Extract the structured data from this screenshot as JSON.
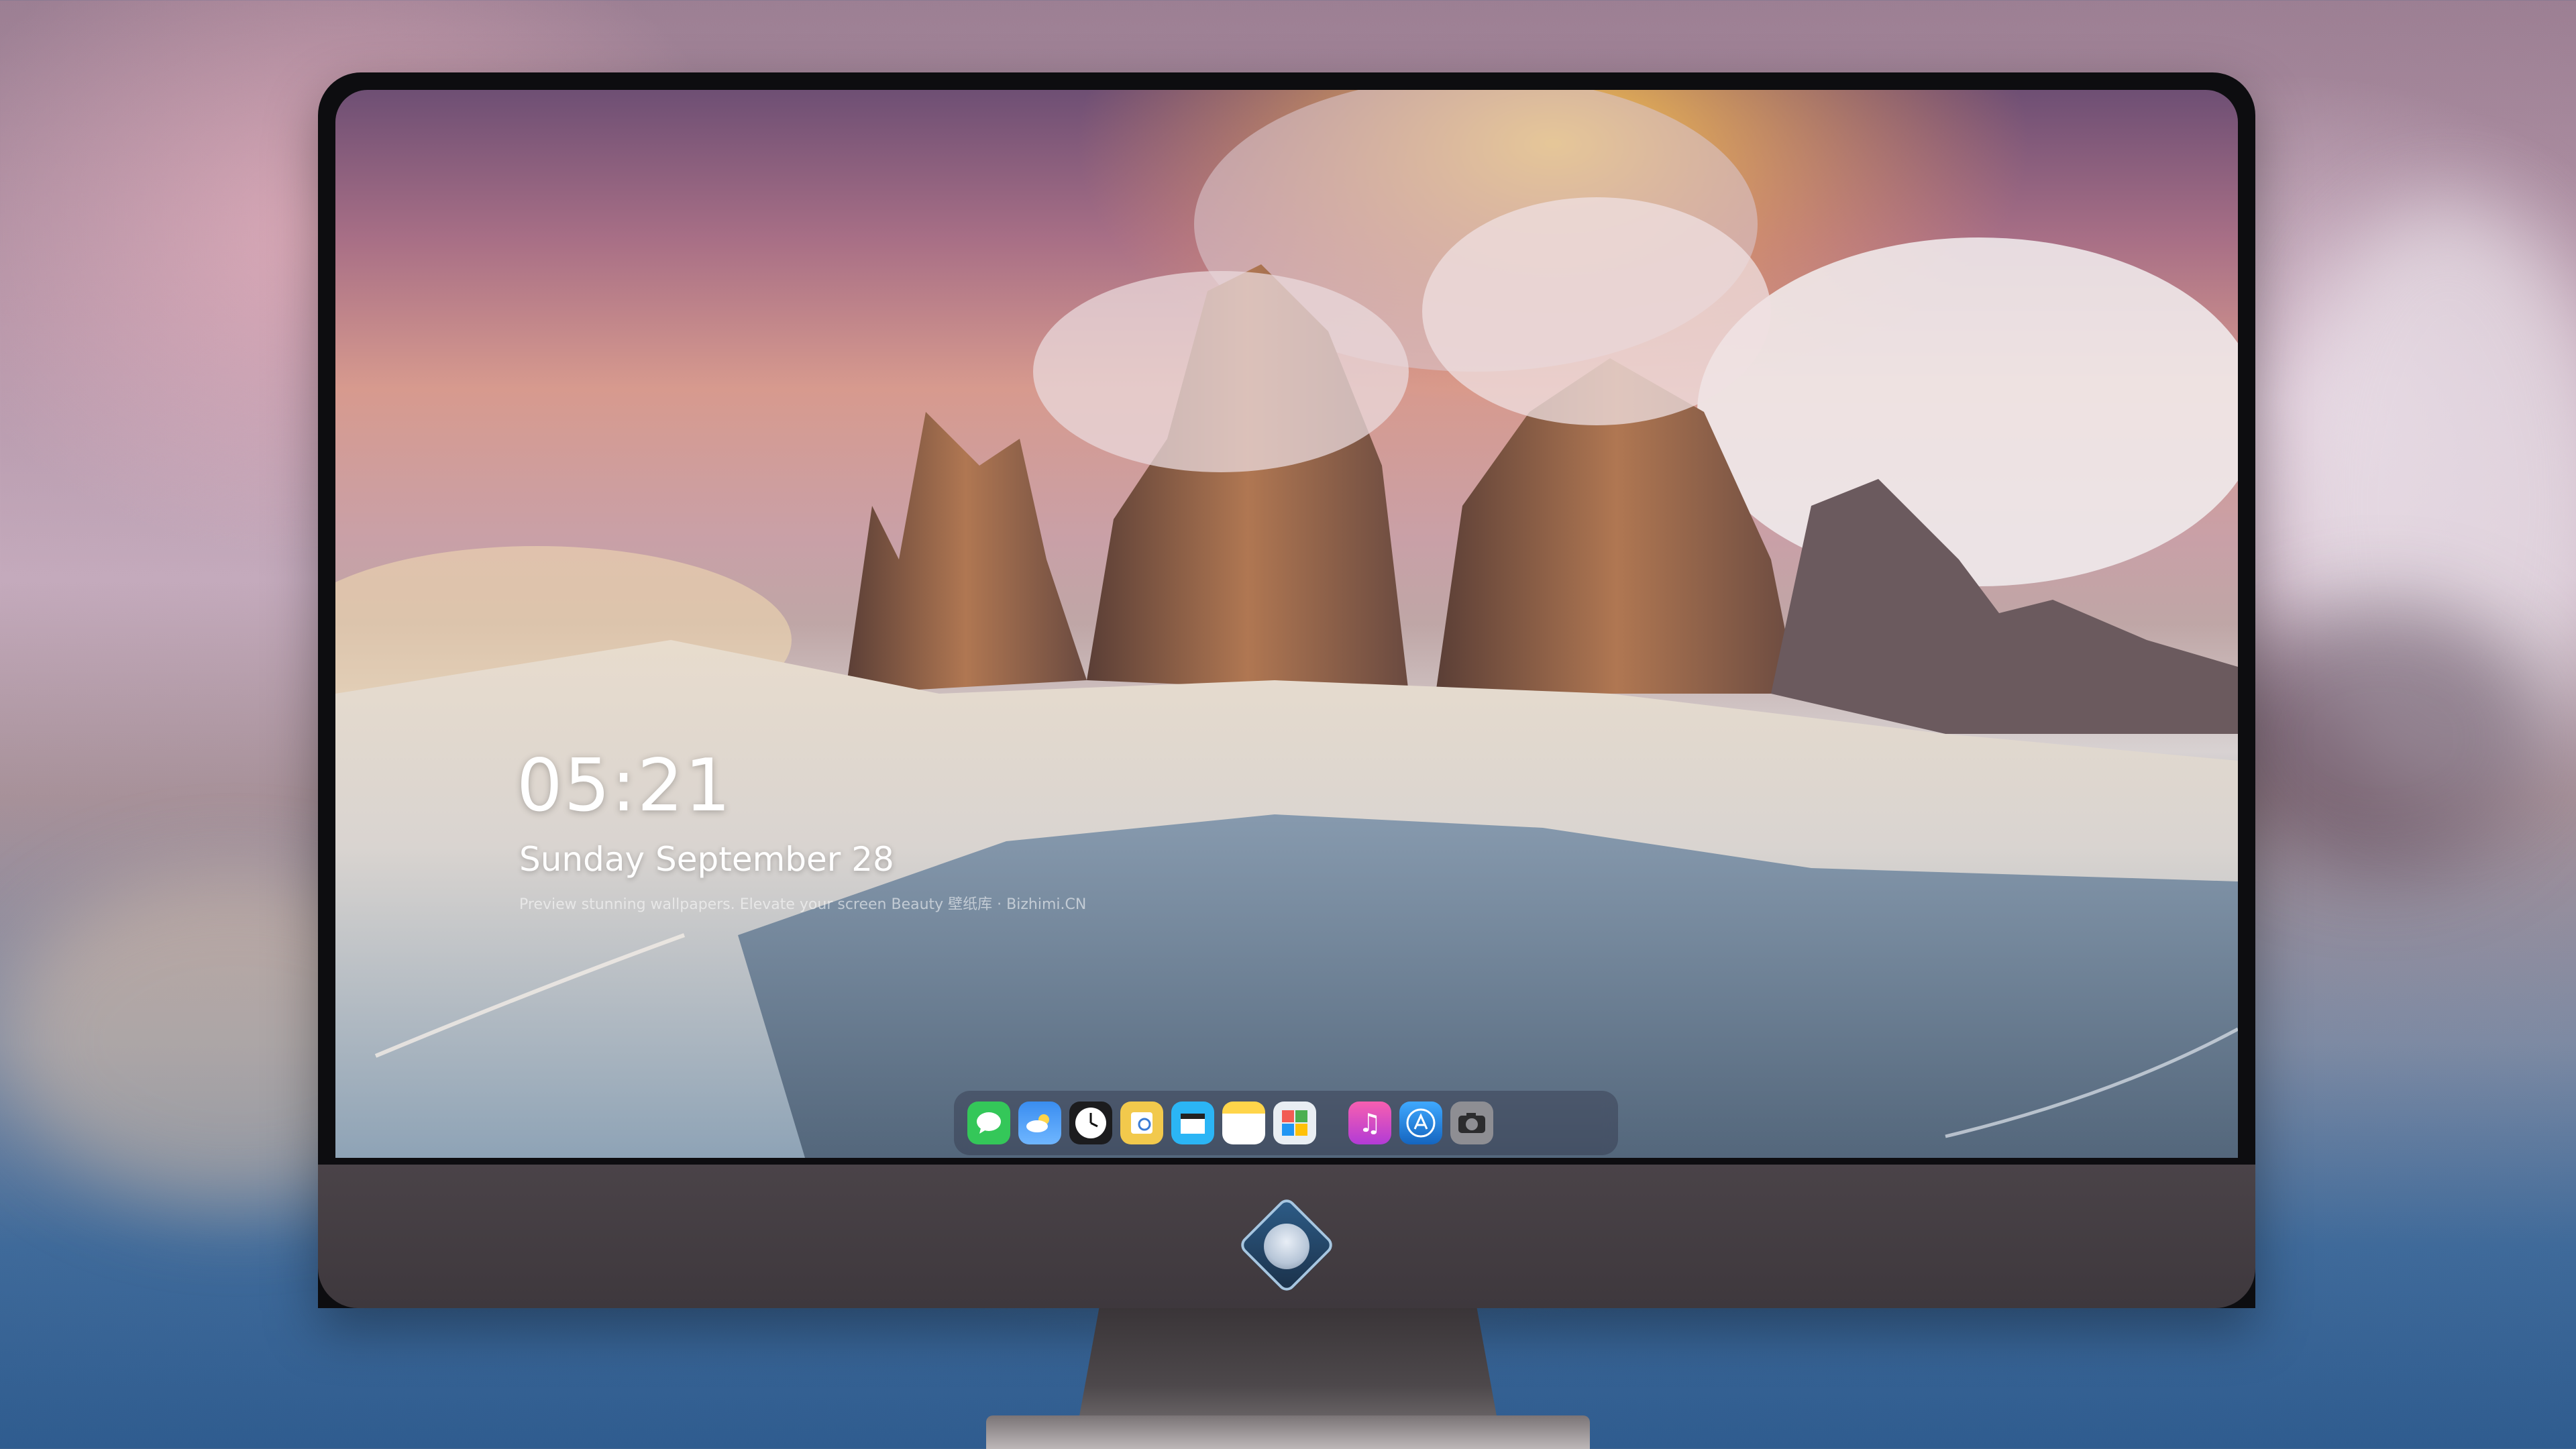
{
  "lock_screen": {
    "time": "05:21",
    "date": "Sunday September  28",
    "caption": "Preview stunning wallpapers. Elevate your screen Beauty 壁纸库 · Bizhimi.CN"
  },
  "dock": {
    "apps": [
      {
        "name": "Messages",
        "icon": "messages-icon",
        "color": "#34c759"
      },
      {
        "name": "Weather",
        "icon": "weather-icon",
        "color": "#3a8df0"
      },
      {
        "name": "Clock",
        "icon": "clock-icon",
        "color": "#1c1c1e"
      },
      {
        "name": "Preview",
        "icon": "preview-icon",
        "color": "#f2c94c"
      },
      {
        "name": "Clips",
        "icon": "clips-icon",
        "color": "#2bb5f5"
      },
      {
        "name": "Notes",
        "icon": "notes-icon",
        "color": "#ffd54a"
      },
      {
        "name": "Photos",
        "icon": "photos-icon",
        "color": "#e9eef3"
      },
      {
        "name": "Music",
        "icon": "music-icon",
        "color": "#e24ca3"
      },
      {
        "name": "App Store",
        "icon": "app-store-icon",
        "color": "#1e88e5"
      },
      {
        "name": "Camera",
        "icon": "camera-icon",
        "color": "#8e8e93"
      }
    ]
  }
}
